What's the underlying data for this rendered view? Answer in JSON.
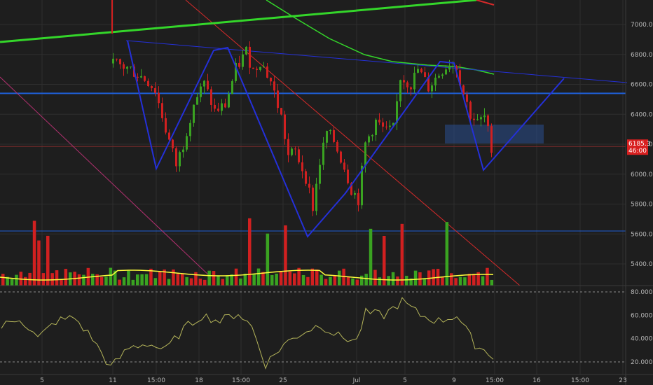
{
  "chart_data": {
    "type": "candlestick",
    "colors": {
      "background": "#1e1e1e",
      "grid": "#2e2e2e",
      "up": "#3aa321",
      "down": "#d12020",
      "volume_ma": "#ffff3b",
      "rsi": "#b5b55a",
      "pattern": "#2430d8",
      "horizontal_level": "#1f5fd6",
      "moving_average": "#34d62a",
      "descending_channel": "#d42a2a",
      "diagonal": "#b0306e",
      "target_box": "#2a4f8f",
      "price_badge": "#d81f1f"
    },
    "price_axis": {
      "ticks": [
        "7000.0",
        "6800.0",
        "6600.0",
        "6400.0",
        "6200.0",
        "6000.0",
        "5800.0",
        "5600.0",
        "5400.0"
      ],
      "range": [
        5250,
        7180
      ]
    },
    "rsi_axis": {
      "ticks": [
        "80.0000",
        "60.0000",
        "40.0000",
        "20.0000"
      ],
      "range": [
        10,
        88
      ],
      "levels": [
        80,
        20
      ]
    },
    "time_axis": {
      "ticks": [
        "5",
        "11",
        "15:00",
        "18",
        "15:00",
        "25",
        "Jul",
        "5",
        "9",
        "15:00",
        "16",
        "15:00",
        "23"
      ]
    },
    "last_price": "6185.3",
    "countdown": "46:00",
    "horizontal_levels": [
      6540,
      5620
    ],
    "price_line": 6185,
    "anchor_prices": [
      {
        "t": 0,
        "p": 6740
      },
      {
        "t": 5,
        "p": 6700
      },
      {
        "t": 10,
        "p": 6620
      },
      {
        "t": 12,
        "p": 6560
      },
      {
        "t": 15,
        "p": 6300
      },
      {
        "t": 18,
        "p": 6060
      },
      {
        "t": 20,
        "p": 6200
      },
      {
        "t": 23,
        "p": 6480
      },
      {
        "t": 26,
        "p": 6600
      },
      {
        "t": 29,
        "p": 6420
      },
      {
        "t": 32,
        "p": 6460
      },
      {
        "t": 35,
        "p": 6700
      },
      {
        "t": 38,
        "p": 6820
      },
      {
        "t": 40,
        "p": 6690
      },
      {
        "t": 42,
        "p": 6760
      },
      {
        "t": 45,
        "p": 6620
      },
      {
        "t": 48,
        "p": 6380
      },
      {
        "t": 50,
        "p": 6120
      },
      {
        "t": 52,
        "p": 6150
      },
      {
        "t": 55,
        "p": 5980
      },
      {
        "t": 57,
        "p": 5780
      },
      {
        "t": 59,
        "p": 6080
      },
      {
        "t": 61,
        "p": 6280
      },
      {
        "t": 63,
        "p": 6220
      },
      {
        "t": 66,
        "p": 6050
      },
      {
        "t": 68,
        "p": 5900
      },
      {
        "t": 70,
        "p": 5830
      },
      {
        "t": 72,
        "p": 6200
      },
      {
        "t": 75,
        "p": 6350
      },
      {
        "t": 78,
        "p": 6280
      },
      {
        "t": 80,
        "p": 6300
      },
      {
        "t": 82,
        "p": 6650
      },
      {
        "t": 85,
        "p": 6600
      },
      {
        "t": 87,
        "p": 6700
      },
      {
        "t": 90,
        "p": 6580
      },
      {
        "t": 92,
        "p": 6640
      },
      {
        "t": 94,
        "p": 6700
      },
      {
        "t": 96,
        "p": 6740
      },
      {
        "t": 98,
        "p": 6720
      },
      {
        "t": 100,
        "p": 6540
      },
      {
        "t": 102,
        "p": 6400
      },
      {
        "t": 104,
        "p": 6340
      },
      {
        "t": 106,
        "p": 6380
      },
      {
        "t": 108,
        "p": 6185
      }
    ],
    "anchor_rsi": [
      {
        "t": 0,
        "v": 50
      },
      {
        "t": 4,
        "v": 58
      },
      {
        "t": 8,
        "v": 40
      },
      {
        "t": 12,
        "v": 55
      },
      {
        "t": 16,
        "v": 58
      },
      {
        "t": 20,
        "v": 40
      },
      {
        "t": 24,
        "v": 15
      },
      {
        "t": 28,
        "v": 32
      },
      {
        "t": 32,
        "v": 36
      },
      {
        "t": 36,
        "v": 30
      },
      {
        "t": 40,
        "v": 48
      },
      {
        "t": 44,
        "v": 60
      },
      {
        "t": 48,
        "v": 55
      },
      {
        "t": 52,
        "v": 62
      },
      {
        "t": 55,
        "v": 50
      },
      {
        "t": 58,
        "v": 18
      },
      {
        "t": 62,
        "v": 35
      },
      {
        "t": 66,
        "v": 45
      },
      {
        "t": 70,
        "v": 52
      },
      {
        "t": 74,
        "v": 42
      },
      {
        "t": 78,
        "v": 38
      },
      {
        "t": 80,
        "v": 62
      },
      {
        "t": 84,
        "v": 60
      },
      {
        "t": 88,
        "v": 72
      },
      {
        "t": 92,
        "v": 60
      },
      {
        "t": 96,
        "v": 55
      },
      {
        "t": 100,
        "v": 60
      },
      {
        "t": 104,
        "v": 35
      },
      {
        "t": 108,
        "v": 25
      }
    ]
  }
}
